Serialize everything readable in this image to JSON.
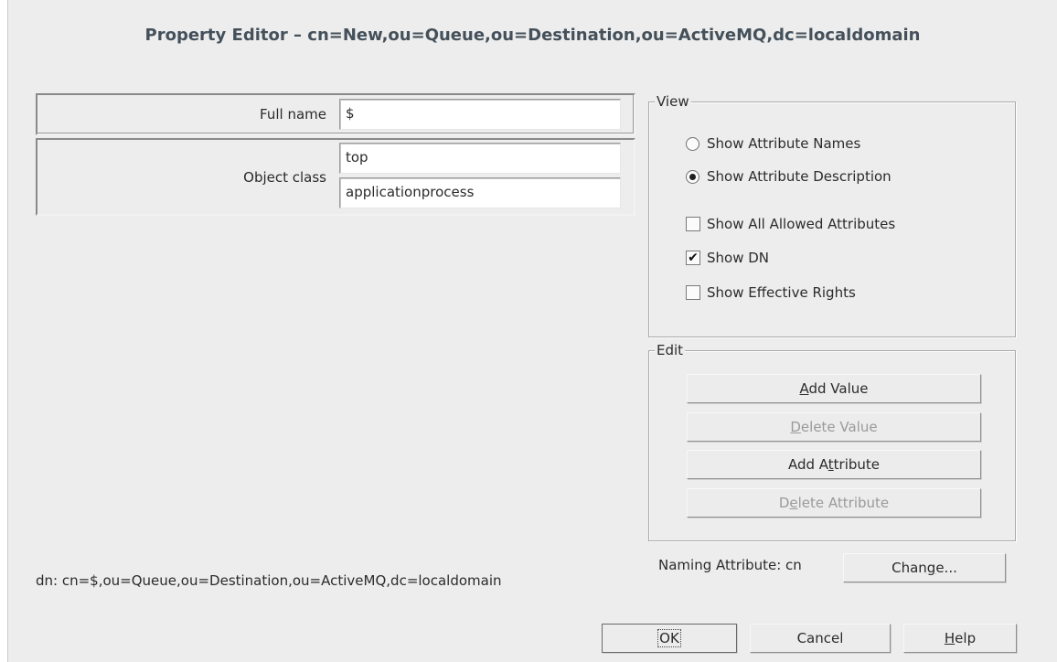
{
  "dialog": {
    "title": "Property Editor – cn=New,ou=Queue,ou=Destination,ou=ActiveMQ,dc=localdomain"
  },
  "attributes": {
    "full_name": {
      "label": "Full name",
      "values": [
        "$"
      ]
    },
    "object_class": {
      "label": "Object class",
      "values": [
        "top",
        "applicationprocess"
      ]
    }
  },
  "view": {
    "title": "View",
    "radios": [
      {
        "label": "Show Attribute Names",
        "selected": false
      },
      {
        "label": "Show Attribute Description",
        "selected": true
      }
    ],
    "checks": [
      {
        "label": "Show All Allowed Attributes",
        "checked": false,
        "mark": ""
      },
      {
        "label": "Show DN",
        "checked": true,
        "mark": "✔"
      },
      {
        "label": "Show Effective Rights",
        "checked": false,
        "mark": ""
      }
    ]
  },
  "edit": {
    "title": "Edit",
    "add_value": {
      "pre": "",
      "mn": "A",
      "post": "dd Value"
    },
    "delete_value": {
      "pre": "",
      "mn": "D",
      "post": "elete Value"
    },
    "add_attribute": {
      "pre": "Add A",
      "mn": "t",
      "post": "tribute"
    },
    "delete_attribute": {
      "pre": "D",
      "mn": "e",
      "post": "lete Attribute"
    }
  },
  "naming": {
    "label": "Naming Attribute: cn",
    "change": {
      "pre": "Chan",
      "mn": "g",
      "post": "e..."
    }
  },
  "dn_text": "dn: cn=$,ou=Queue,ou=Destination,ou=ActiveMQ,dc=localdomain",
  "footer": {
    "ok": "OK",
    "cancel": "Cancel",
    "help": {
      "pre": "",
      "mn": "H",
      "post": "elp"
    }
  },
  "colors": {
    "dialog_bg": "#ededed",
    "title": "#44505a",
    "disabled_text": "#9a9a9a"
  }
}
